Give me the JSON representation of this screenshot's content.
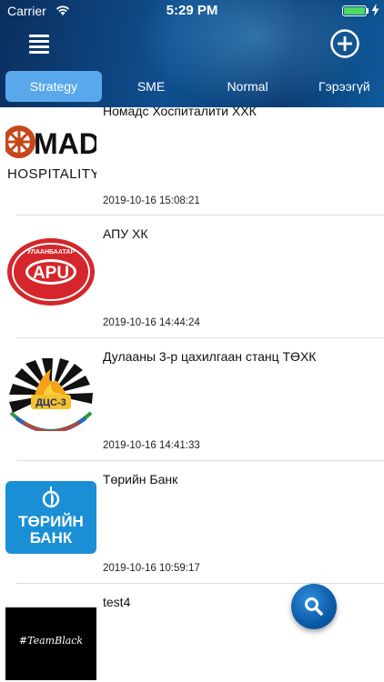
{
  "status_bar": {
    "carrier": "Carrier",
    "time": "5:29 PM"
  },
  "tabs": [
    {
      "label": "Strategy",
      "active": true
    },
    {
      "label": "SME",
      "active": false
    },
    {
      "label": "Normal",
      "active": false
    },
    {
      "label": "Гэрээгүй",
      "active": false
    }
  ],
  "items": [
    {
      "name": "Номадс Хоспиталити ХХК",
      "date": "2019-10-16 15:08:21",
      "logo_text_1": "MAD",
      "logo_text_2": "HOSPITALITY"
    },
    {
      "name": "АПУ ХК",
      "date": "2019-10-16 14:44:24",
      "logo_text_1": "APU",
      "logo_text_2": "УЛААНБААТАР"
    },
    {
      "name": "Дулааны 3-р цахилгаан станц ТӨХК",
      "date": "2019-10-16 14:41:33",
      "logo_text_1": "ДЦС-3"
    },
    {
      "name": "Төрийн Банк",
      "date": "2019-10-16 10:59:17",
      "logo_text_1": "ТӨРИЙН",
      "logo_text_2": "БАНК"
    },
    {
      "name": "test4",
      "date": "",
      "logo_text_1": "#TeamBlack"
    }
  ],
  "colors": {
    "header_dark": "#0b2e5e",
    "active_tab": "#5aa8ec",
    "fab": "#0c5aa6",
    "battery": "#4cd964"
  }
}
